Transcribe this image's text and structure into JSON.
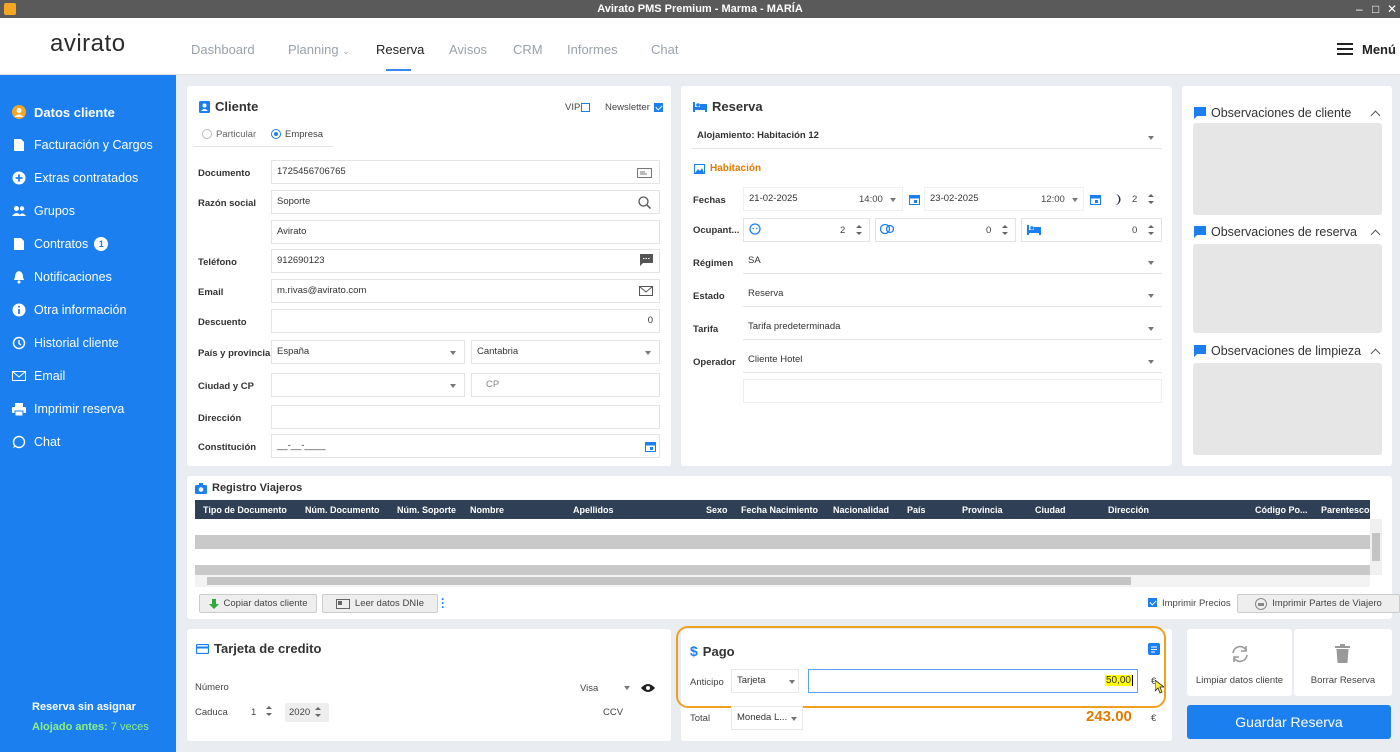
{
  "window": {
    "title": "Avirato PMS Premium - Marma - MARÍA",
    "minimize": "–",
    "maximize": "□",
    "close": "✕"
  },
  "nav": {
    "logo": "avirato",
    "tabs": [
      "Dashboard",
      "Planning",
      "Reserva",
      "Avisos",
      "CRM",
      "Informes",
      "Chat"
    ],
    "active_tab": "Reserva",
    "menu_label": "Menú"
  },
  "sidebar": {
    "items": [
      {
        "label": "Datos cliente",
        "icon": "user-icon"
      },
      {
        "label": "Facturación y Cargos",
        "icon": "document-icon"
      },
      {
        "label": "Extras contratados",
        "icon": "plus-circle-icon"
      },
      {
        "label": "Grupos",
        "icon": "group-icon"
      },
      {
        "label": "Contratos",
        "icon": "contract-icon",
        "badge": "1"
      },
      {
        "label": "Notificaciones",
        "icon": "bell-icon"
      },
      {
        "label": "Otra información",
        "icon": "info-icon"
      },
      {
        "label": "Historial cliente",
        "icon": "history-icon"
      },
      {
        "label": "Email",
        "icon": "mail-icon"
      },
      {
        "label": "Imprimir reserva",
        "icon": "printer-icon"
      },
      {
        "label": "Chat",
        "icon": "chat-icon"
      }
    ],
    "footer_status": "Reserva sin asignar",
    "footer_prev_label": "Alojado antes:",
    "footer_prev_value": "7 veces"
  },
  "cliente": {
    "title": "Cliente",
    "vip_label": "VIP",
    "vip_checked": false,
    "newsletter_label": "Newsletter",
    "newsletter_checked": true,
    "type_options": [
      "Particular",
      "Empresa"
    ],
    "type_selected": "Empresa",
    "documento_label": "Documento",
    "documento": "1725456706765",
    "razon_label": "Razón social",
    "razon": "Soporte",
    "razon2": "Avirato",
    "telefono_label": "Teléfono",
    "telefono": "912690123",
    "email_label": "Email",
    "email": "m.rivas@avirato.com",
    "descuento_label": "Descuento",
    "descuento": "0",
    "pais_label": "País y provincia",
    "pais": "España",
    "provincia": "Cantabria",
    "ciudad_label": "Ciudad y  CP",
    "ciudad": "",
    "cp_placeholder": "CP",
    "direccion_label": "Dirección",
    "direccion": "",
    "constitucion_label": "Constitución",
    "constitucion": "__-__-____"
  },
  "reserva": {
    "title": "Reserva",
    "alojamiento": "Alojamiento: Habitación 12",
    "habitacion_link": "Habitación",
    "fechas_label": "Fechas",
    "fecha_entrada": "21-02-2025",
    "hora_entrada": "14:00",
    "fecha_salida": "23-02-2025",
    "hora_salida": "12:00",
    "noches": "2",
    "ocupantes_label": "Ocupant...",
    "adultos": "2",
    "ninos": "0",
    "camas": "0",
    "regimen_label": "Régimen",
    "regimen": "SA",
    "estado_label": "Estado",
    "estado": "Reserva",
    "tarifa_label": "Tarifa",
    "tarifa": "Tarifa predeterminada",
    "operador_label": "Operador",
    "operador": "Cliente Hotel"
  },
  "observaciones": {
    "cliente": "Observaciones de cliente",
    "reserva": "Observaciones de reserva",
    "limpieza": "Observaciones de limpieza"
  },
  "registro": {
    "title": "Registro Viajeros",
    "columns": [
      "Tipo de Documento",
      "Núm. Documento",
      "Núm. Soporte",
      "Nombre",
      "Apellidos",
      "Sexo",
      "Fecha Nacimiento",
      "Nacionalidad",
      "País",
      "Provincia",
      "Ciudad",
      "Dirección",
      "Código Po...",
      "Parentesco"
    ],
    "copy_button": "Copiar datos cliente",
    "read_button": "Leer datos DNIe",
    "print_prices_label": "Imprimir Precios",
    "print_prices_checked": true,
    "print_parts_button": "Imprimir Partes de Viajero"
  },
  "tarjeta": {
    "title": "Tarjeta de credito",
    "numero_label": "Número",
    "card_type": "Visa",
    "caduca_label": "Caduca",
    "mes": "1",
    "anio": "2020",
    "ccv_label": "CCV"
  },
  "pago": {
    "title": "Pago",
    "anticipo_label": "Anticipo",
    "metodo": "Tarjeta",
    "anticipo_value": "50,00",
    "currency": "€",
    "total_label": "Total",
    "moneda": "Moneda L...",
    "total_value": "243.00",
    "highlight_color": "#f0a020"
  },
  "actions": {
    "limpiar": "Limpiar datos cliente",
    "borrar": "Borrar Reserva",
    "guardar": "Guardar Reserva"
  },
  "colors": {
    "primary": "#1b7ff0",
    "sidebar": "#1b7ff0",
    "table_header": "#2f3f55",
    "total": "#e07b00"
  }
}
